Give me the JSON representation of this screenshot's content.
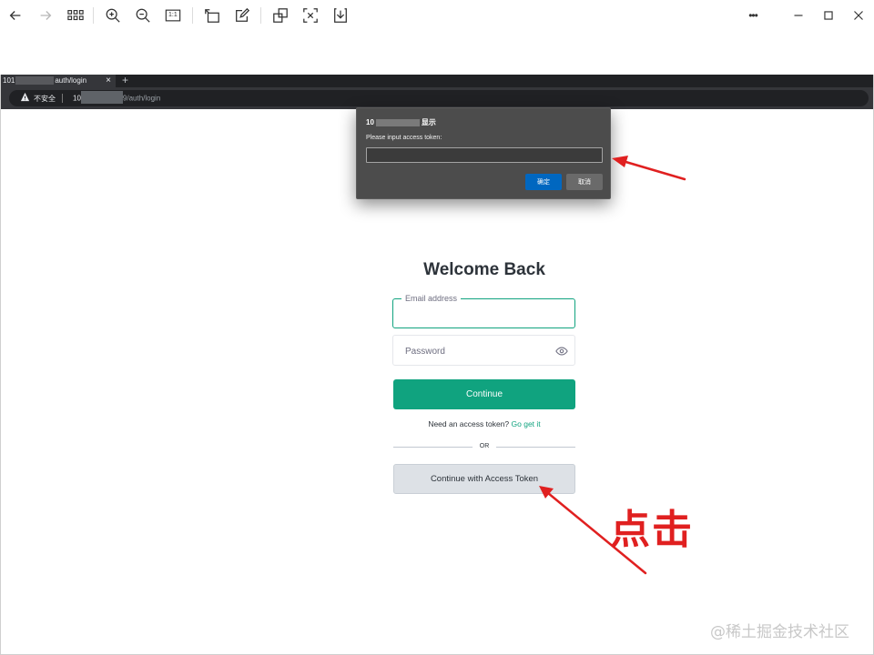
{
  "viewer": {
    "toolbar_icons": [
      "arrow-left-icon",
      "arrow-right-icon",
      "grid-icon",
      "zoom-in-icon",
      "zoom-out-icon",
      "actual-size-icon",
      "rotate-icon",
      "edit-icon",
      "crop-icon",
      "fullscreen-icon",
      "download-icon",
      "more-icon",
      "minimize-icon",
      "maximize-icon",
      "close-icon"
    ],
    "actual_size_label": "1:1",
    "more_label": "•••"
  },
  "browser": {
    "tab_prefix": "101",
    "tab_suffix": "auth/login",
    "tab_close": "×",
    "new_tab": "+",
    "insecure_label": "不安全",
    "url_host": "10",
    "url_path": "9/auth/login"
  },
  "dialog": {
    "title_prefix": "10",
    "title_suffix": "显示",
    "message": "Please input access token:",
    "input_value": "",
    "ok_label": "确定",
    "cancel_label": "取消"
  },
  "login": {
    "title": "Welcome Back",
    "email_label": "Email address",
    "email_value": "",
    "password_placeholder": "Password",
    "continue_label": "Continue",
    "need_token_text": "Need an access token?",
    "get_it_link": "Go get it",
    "or_text": "OR",
    "token_button_label": "Continue with Access Token"
  },
  "annotations": {
    "click_note": "点击",
    "arrow_color": "#e02020"
  },
  "watermark": "@稀土掘金技术社区",
  "colors": {
    "accent": "#10a37f",
    "dialog_bg": "#4c4c4c",
    "dialog_ok": "#0067c0"
  }
}
